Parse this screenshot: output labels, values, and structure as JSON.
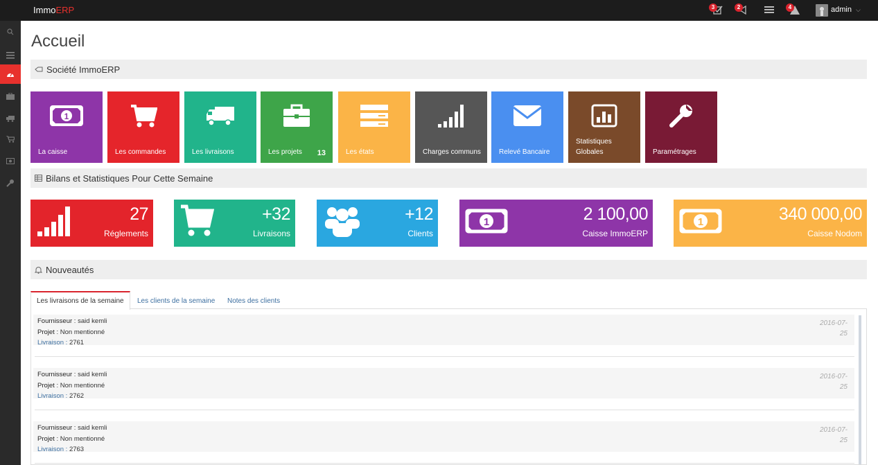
{
  "topbar": {
    "brand_prefix": "Immo",
    "brand_suffix": "ERP",
    "badges": {
      "tasks": "3",
      "messages": "2",
      "notifications": "4"
    },
    "username": "admin"
  },
  "page": {
    "title": "Accueil"
  },
  "sections": {
    "societe": "Société ImmoERP",
    "bilans": "Bilans et Statistiques Pour Cette Semaine",
    "nouveautes": "Nouveautés"
  },
  "tiles": [
    {
      "label": "La caisse",
      "color": "#8e35a8",
      "icon": "money-icon"
    },
    {
      "label": "Les commandes",
      "color": "#e5252b",
      "icon": "cart-icon"
    },
    {
      "label": "Les livraisons",
      "color": "#21b48b",
      "icon": "truck-icon"
    },
    {
      "label": "Les projets",
      "count": "13",
      "color": "#3ea549",
      "icon": "briefcase-icon"
    },
    {
      "label": "Les états",
      "color": "#fbb447",
      "icon": "list-icon"
    },
    {
      "label": "Charges communs",
      "color": "#565656",
      "icon": "signal-icon"
    },
    {
      "label": "Relevé Bancaire",
      "color": "#4a8ff0",
      "icon": "envelope-icon"
    },
    {
      "label": "Statistiques Globales",
      "color": "#7a4a2a",
      "icon": "chart-icon"
    },
    {
      "label": "Paramétrages",
      "color": "#791a35",
      "icon": "wrench-icon"
    }
  ],
  "stats": [
    {
      "value": "27",
      "label": "Réglements",
      "color": "#e3242b",
      "icon": "signal-icon"
    },
    {
      "value": "+32",
      "label": "Livraisons",
      "color": "#21b48b",
      "icon": "cart-icon"
    },
    {
      "value": "+12",
      "label": "Clients",
      "color": "#2aa7e0",
      "icon": "users-icon"
    },
    {
      "value": "2 100,00",
      "label": "Caisse ImmoERP",
      "color": "#8e35a8",
      "icon": "money-icon"
    },
    {
      "value": "340 000,00",
      "label": "Caisse Nodom",
      "color": "#fbb447",
      "icon": "money-icon"
    }
  ],
  "tabs": [
    "Les livraisons de la semaine",
    "Les clients de la semaine",
    "Notes des clients"
  ],
  "feed": [
    {
      "fournisseur_label": "Fournisseur",
      "fournisseur": "said kemli",
      "projet_label": "Projet",
      "projet": "Non mentionné",
      "livraison_label": "Livraison",
      "livraison": "2761",
      "date_a": "2016-07-",
      "date_b": "25"
    },
    {
      "fournisseur_label": "Fournisseur",
      "fournisseur": "said kemli",
      "projet_label": "Projet",
      "projet": "Non mentionné",
      "livraison_label": "Livraison",
      "livraison": "2762",
      "date_a": "2016-07-",
      "date_b": "25"
    },
    {
      "fournisseur_label": "Fournisseur",
      "fournisseur": "said kemli",
      "projet_label": "Projet",
      "projet": "Non mentionné",
      "livraison_label": "Livraison",
      "livraison": "2763",
      "date_a": "2016-07-",
      "date_b": "25"
    }
  ]
}
